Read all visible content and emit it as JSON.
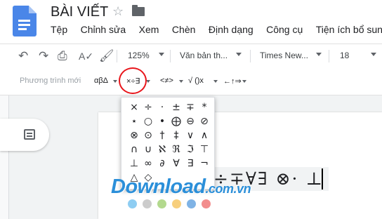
{
  "app": {
    "doc_title": "BÀI VIẾT",
    "menu": [
      "Tệp",
      "Chỉnh sửa",
      "Xem",
      "Chèn",
      "Định dạng",
      "Công cụ",
      "Tiện ích bổ sung"
    ]
  },
  "toolbar": {
    "zoom": "125%",
    "style": "Văn bản th...",
    "font": "Times New...",
    "font_size": "18",
    "icons": [
      "undo-icon",
      "redo-icon",
      "print-icon",
      "spellcheck-icon",
      "paint-format-icon"
    ]
  },
  "equation_bar": {
    "new_equation": "Phương trình mới",
    "groups": [
      "αβΔ",
      "×÷∃",
      "<≠>",
      "√ ()x",
      "←↑⇒"
    ]
  },
  "palette": {
    "rows": [
      [
        "×",
        "÷",
        "·",
        "±",
        "∓",
        "*"
      ],
      [
        "⋆",
        "○",
        "•",
        "⨁",
        "⊖",
        "⊘"
      ],
      [
        "⊗",
        "⊙",
        "†",
        "‡",
        "∨",
        "∧"
      ],
      [
        "∩",
        "∪",
        "ℵ",
        "ℜ",
        "ℑ",
        "⊤"
      ],
      [
        "⊥",
        "∞",
        "∂",
        "∀",
        "∃",
        "¬"
      ],
      [
        "△",
        "◇"
      ]
    ]
  },
  "document": {
    "equation_text": "÷∓∀∃ ⊗· ⊥"
  },
  "watermark": {
    "brand": "Download",
    "tld": ".com.vn",
    "dot_colors": [
      "#8ecdf2",
      "#cccccc",
      "#b3d98e",
      "#f7cf7d",
      "#7fb3e5",
      "#f28d8d"
    ]
  }
}
